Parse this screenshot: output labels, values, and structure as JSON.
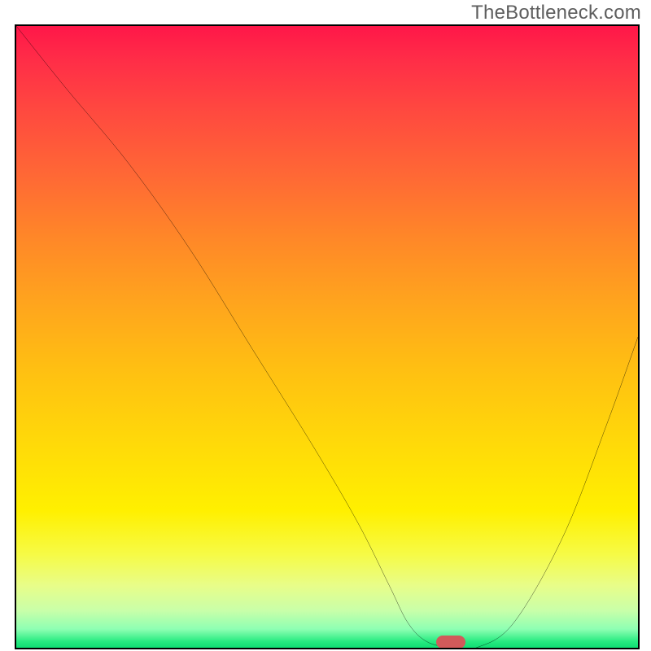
{
  "watermark": "TheBottleneck.com",
  "chart_data": {
    "type": "line",
    "title": "",
    "xlabel": "",
    "ylabel": "",
    "xlim": [
      0,
      100
    ],
    "ylim": [
      0,
      100
    ],
    "series": [
      {
        "name": "curve",
        "x": [
          0,
          8,
          18,
          28,
          38,
          48,
          55,
          60,
          63,
          66,
          70,
          74,
          80,
          88,
          95,
          100
        ],
        "y": [
          100,
          90,
          78,
          64,
          48,
          32,
          20,
          10,
          4,
          1,
          0,
          0,
          4,
          18,
          36,
          50
        ]
      }
    ],
    "marker": {
      "x": 70,
      "y": 0,
      "color": "#d15a5a"
    },
    "background": "red-yellow-green vertical gradient"
  }
}
